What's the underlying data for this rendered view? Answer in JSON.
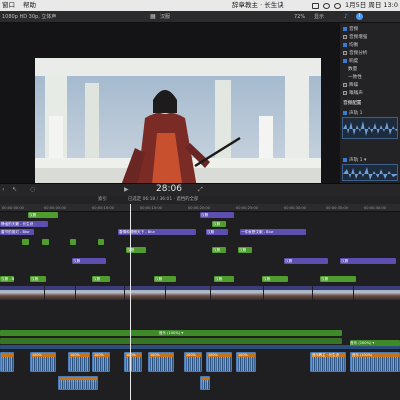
{
  "menubar": {
    "items": [
      "窗口",
      "帮助"
    ],
    "app_title": "辞章教主 · 长生诀",
    "time": "1月5日 周日 13:0"
  },
  "viewer": {
    "left_info": "1080p HD 30p, 立体声",
    "title": "汉服",
    "zoom": "72%",
    "view_label": "显示"
  },
  "inspector": {
    "header_label": "音频",
    "rows": [
      "音频增强",
      "均衡",
      "音频分析",
      "响度",
      "数量",
      "一致性",
      "降噪",
      "嗡嗡声",
      "音频配置"
    ],
    "track1_label": "声轨 1",
    "track2_label": "声轨 1 ▾"
  },
  "timeline": {
    "timecode": "28:06",
    "index_label": "索引",
    "project_info": "已选定 06:18 / 36:01 · 遮挡的全部",
    "ruler": [
      "00:00:00:00",
      "00:00:05:00",
      "00:00:10:00",
      "00:00:15:00",
      "00:00:20:00",
      "00:00:25:00",
      "00:00:30:00",
      "00:00:35:00",
      "00:00:40:00",
      "00:00:45:00"
    ],
    "title_clips": [
      "静谧的天籁 - 长生诀",
      "汉服",
      "春节的赏灯 - Blur",
      "春情和晴朗天下 - Blur",
      "汉服",
      "一件就是汉服 - Blur",
      "汉服",
      "汉服",
      "汉服",
      "汉服"
    ],
    "connected_clips": [
      "汉服",
      "汉服",
      "汉服",
      "汉服",
      "汉服 - Blur",
      "汉服",
      "汉服",
      "汉服",
      "汉服",
      "汉服",
      "汉服",
      "汉服"
    ],
    "music_label": "音乐 (100%) ▾",
    "music2_label": "音乐 (100%) ▾",
    "audio_clips": [
      {
        "label": "100%"
      },
      {
        "label": "100%"
      },
      {
        "label": "100%"
      },
      {
        "label": "100%"
      },
      {
        "label": "100%"
      },
      {
        "label": "100%"
      },
      {
        "label": "100%"
      },
      {
        "label": "100%"
      },
      {
        "label": "音乐 (100%)"
      },
      {
        "label": "音乐教主 · 长生诀"
      }
    ]
  },
  "colors": {
    "title_clip": "#5d4fb0",
    "connected_clip": "#4f9d2f",
    "audio_clip": "#cf7b1c",
    "primary": "#305d98"
  }
}
